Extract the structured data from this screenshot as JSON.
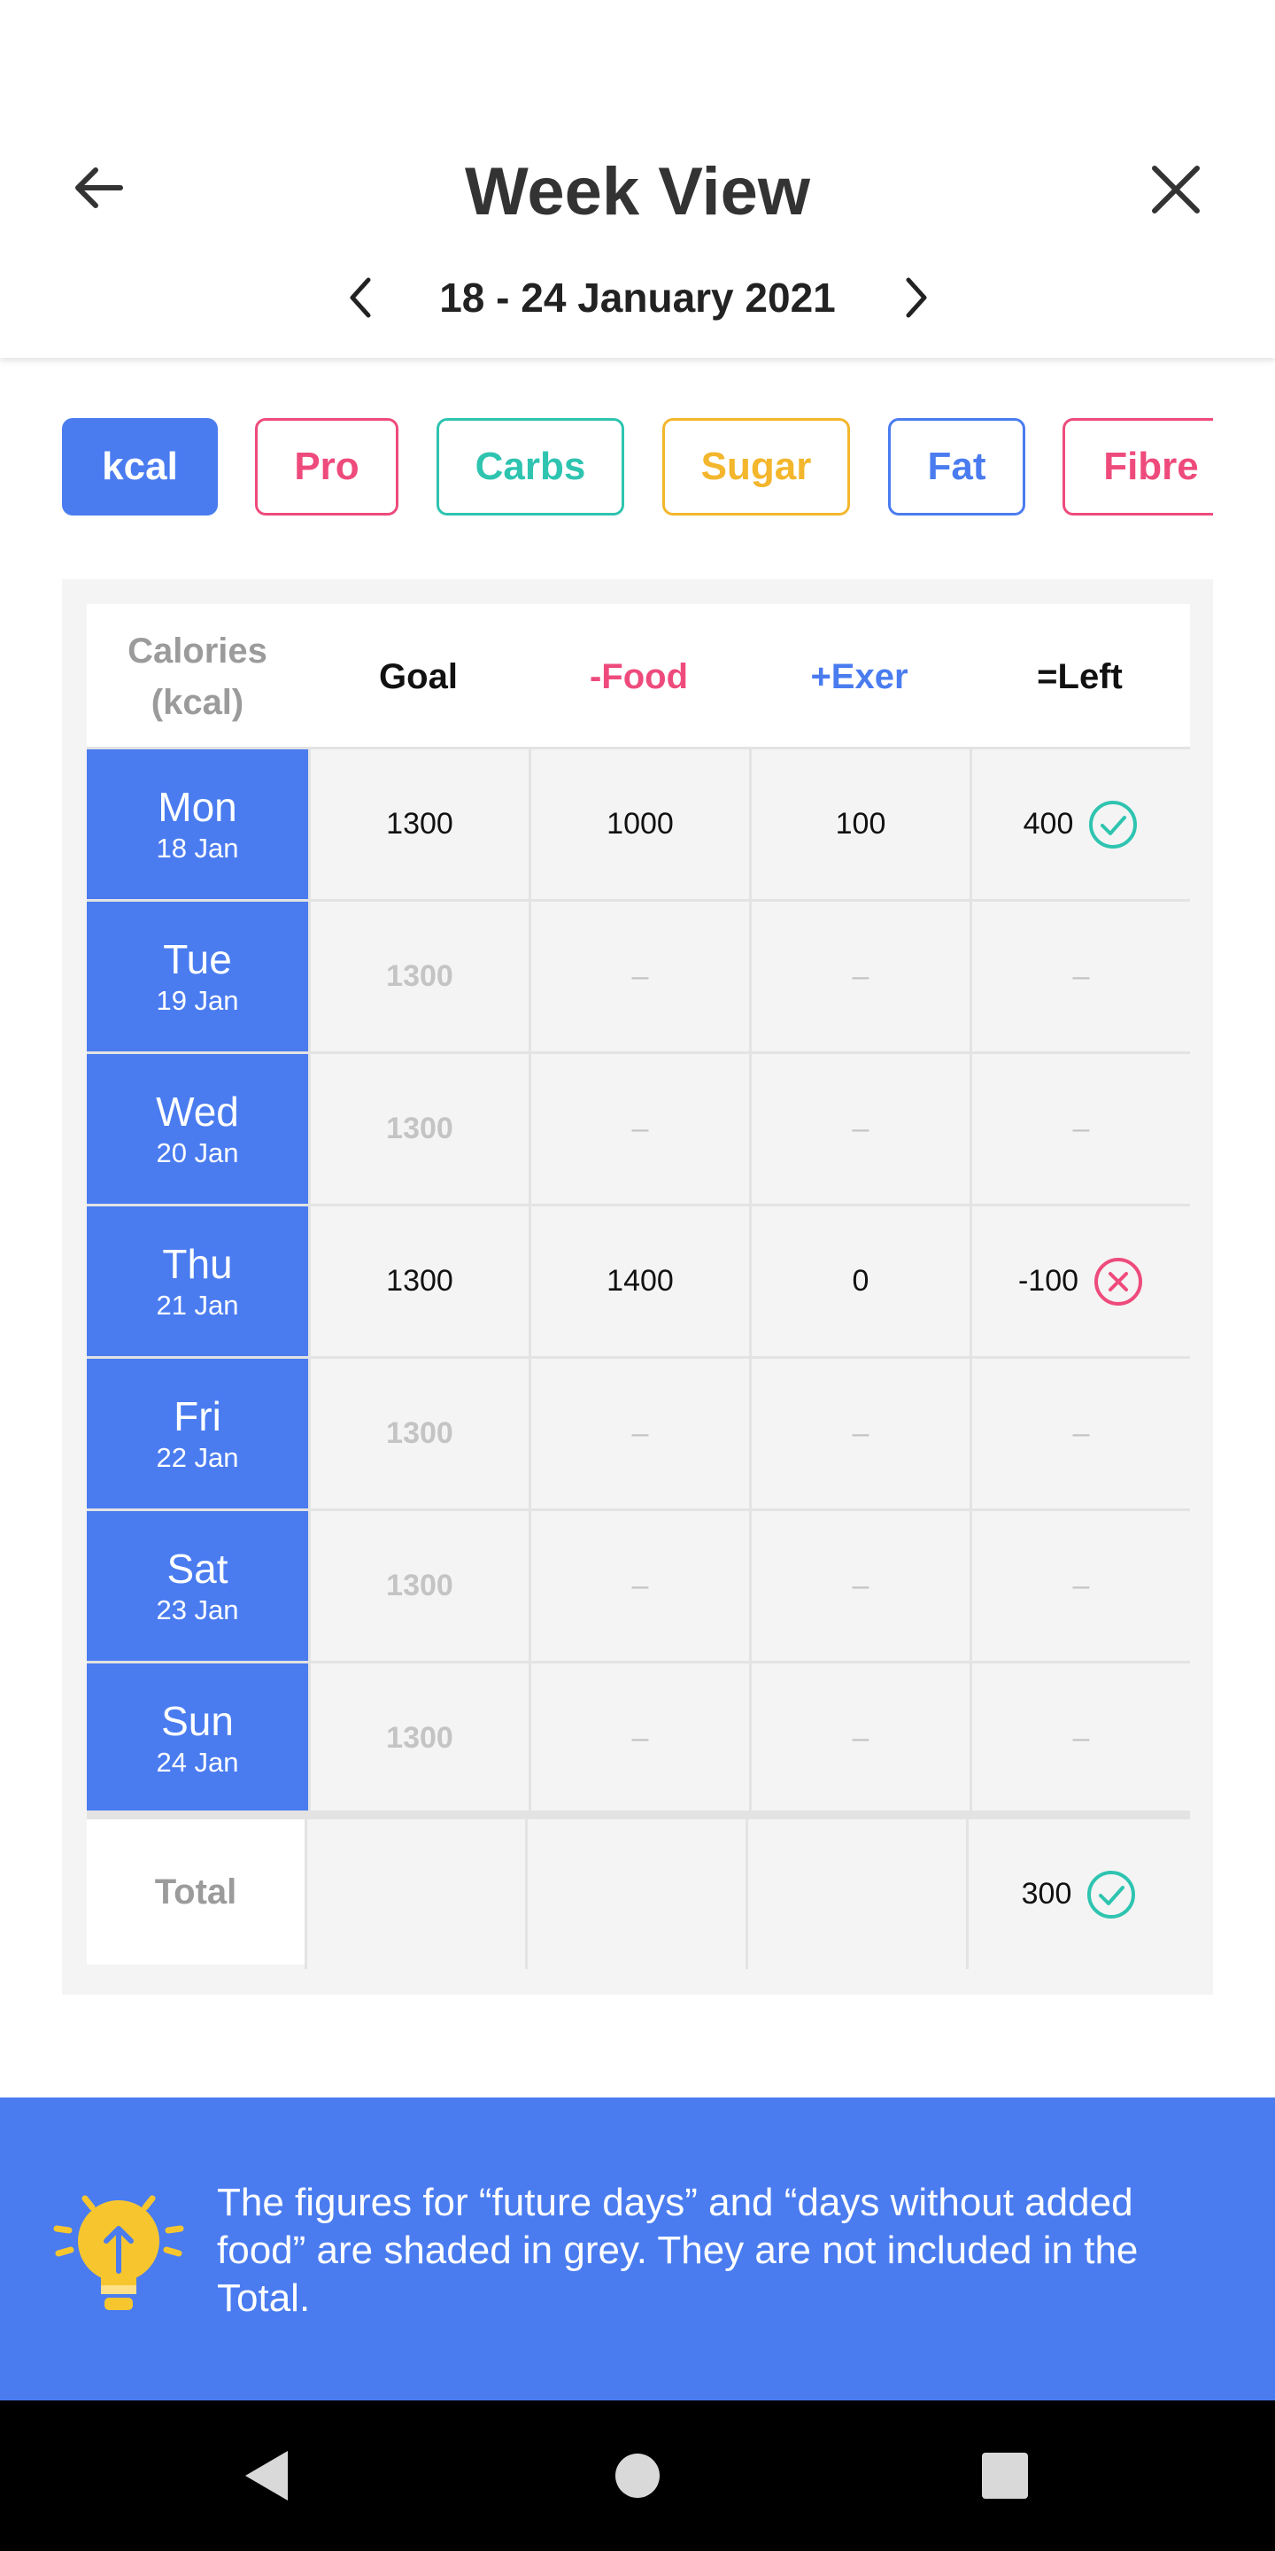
{
  "header": {
    "title": "Week View",
    "date_range": "18 - 24 January 2021"
  },
  "icons": {
    "back": "arrow-left-icon",
    "close": "close-icon",
    "prev": "chevron-left-icon",
    "next": "chevron-right-icon",
    "ok": "check-circle-icon",
    "over": "cross-circle-icon",
    "tip": "lightbulb-icon"
  },
  "chips": [
    {
      "label": "kcal",
      "color": "#4a7cf0",
      "selected": true
    },
    {
      "label": "Pro",
      "color": "#ee4b7c",
      "selected": false
    },
    {
      "label": "Carbs",
      "color": "#2ec4b0",
      "selected": false
    },
    {
      "label": "Sugar",
      "color": "#f3b62c",
      "selected": false
    },
    {
      "label": "Fat",
      "color": "#4a7cf0",
      "selected": false
    },
    {
      "label": "Fibre",
      "color": "#ee4b7c",
      "selected": false
    }
  ],
  "table": {
    "headers": {
      "calories_line1": "Calories",
      "calories_line2": "(kcal)",
      "goal": "Goal",
      "food": "-Food",
      "exer": "+Exer",
      "left": "=Left"
    },
    "header_colors": {
      "goal": "#111111",
      "food": "#ee4b7c",
      "exer": "#4a7cf0",
      "left": "#111111"
    },
    "rows": [
      {
        "day": "Mon",
        "date": "18 Jan",
        "goal": "1300",
        "food": "1000",
        "exer": "100",
        "left": "400",
        "status": "ok",
        "future": false
      },
      {
        "day": "Tue",
        "date": "19 Jan",
        "goal": "1300",
        "food": "–",
        "exer": "–",
        "left": "–",
        "status": "",
        "future": true
      },
      {
        "day": "Wed",
        "date": "20 Jan",
        "goal": "1300",
        "food": "–",
        "exer": "–",
        "left": "–",
        "status": "",
        "future": true
      },
      {
        "day": "Thu",
        "date": "21 Jan",
        "goal": "1300",
        "food": "1400",
        "exer": "0",
        "left": "-100",
        "status": "over",
        "future": false
      },
      {
        "day": "Fri",
        "date": "22 Jan",
        "goal": "1300",
        "food": "–",
        "exer": "–",
        "left": "–",
        "status": "",
        "future": true
      },
      {
        "day": "Sat",
        "date": "23 Jan",
        "goal": "1300",
        "food": "–",
        "exer": "–",
        "left": "–",
        "status": "",
        "future": true
      },
      {
        "day": "Sun",
        "date": "24 Jan",
        "goal": "1300",
        "food": "–",
        "exer": "–",
        "left": "–",
        "status": "",
        "future": true
      }
    ],
    "total": {
      "label": "Total",
      "left": "300",
      "status": "ok"
    }
  },
  "colors": {
    "accent": "#4a7cf0",
    "ok": "#2ec4b0",
    "over": "#ee4b7c",
    "bulb": "#f7c62f"
  },
  "tip": {
    "text": "The figures for “future days” and “days without added food” are shaded in grey. They are not included in the Total."
  },
  "navbar": {
    "back": "nav-back-icon",
    "home": "nav-home-icon",
    "recents": "nav-recents-icon"
  }
}
